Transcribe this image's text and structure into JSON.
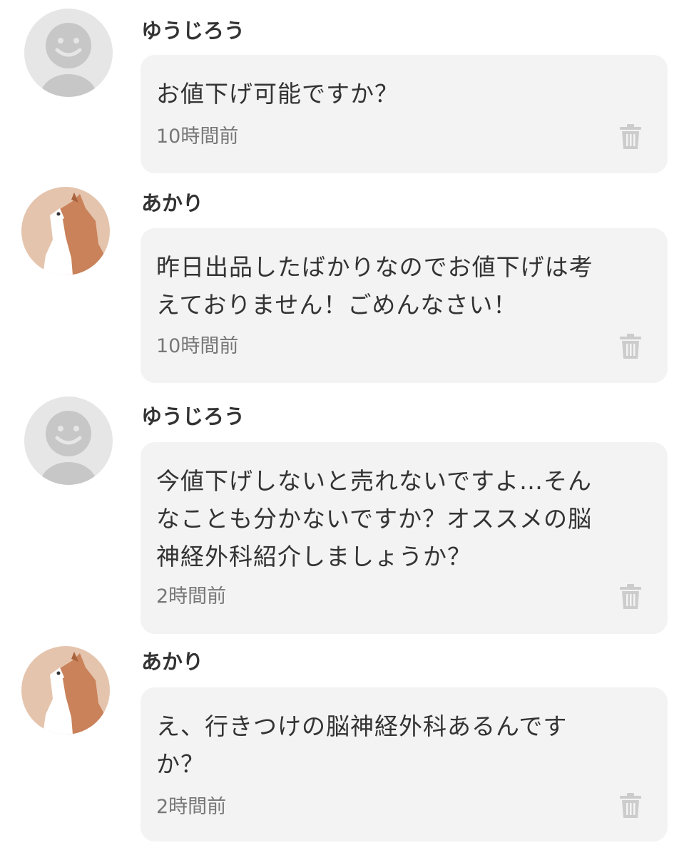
{
  "comments": [
    {
      "user": "ゆうじろう",
      "avatar": "default-smiley-avatar",
      "lines": [
        "お値下げ可能ですか？"
      ],
      "time": "10時間前"
    },
    {
      "user": "あかり",
      "avatar": "cat-avatar",
      "lines": [
        "昨日出品したばかりなのでお値下げは考",
        "えておりません！ごめんなさい！"
      ],
      "time": "10時間前"
    },
    {
      "user": "ゆうじろう",
      "avatar": "default-smiley-avatar",
      "lines": [
        "今値下げしないと売れないですよ…そん",
        "なことも分かないですか？オススメの脳",
        "神経外科紹介しましょうか？"
      ],
      "time": "2時間前"
    },
    {
      "user": "あかり",
      "avatar": "cat-avatar",
      "lines": [
        "え、行きつけの脳神経外科あるんです",
        "か？"
      ],
      "time": "2時間前"
    }
  ],
  "icons": {
    "delete": "trash-icon"
  },
  "colors": {
    "bubble": "#f3f3f3",
    "text": "#333333",
    "timestamp": "#777777",
    "trash": "#cccccc",
    "default_avatar_bg": "#e6e6e6",
    "default_avatar_fg": "#c7c7c7",
    "cat_avatar_bg": "#e5c4ad"
  }
}
